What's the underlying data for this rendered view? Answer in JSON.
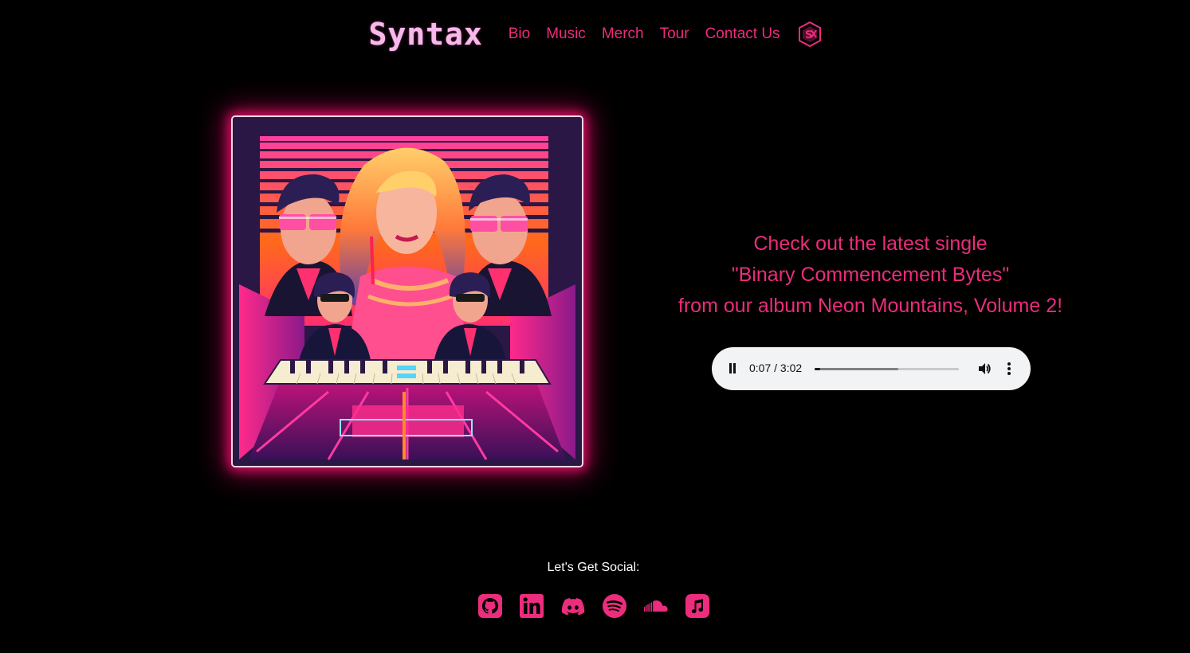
{
  "header": {
    "logo": "Syntax",
    "nav": [
      {
        "label": "Bio"
      },
      {
        "label": "Music"
      },
      {
        "label": "Merch"
      },
      {
        "label": "Tour"
      },
      {
        "label": "Contact Us"
      }
    ],
    "badge_icon": "band-emblem-icon"
  },
  "colors": {
    "accent": "#ec2c7c",
    "logo": "#f7b8ea",
    "background": "#000000",
    "player_bg": "#f1f3f4"
  },
  "album": {
    "icon": "album-cover-image"
  },
  "promo": {
    "line1": "Check out the latest single",
    "line2": "\"Binary Commencement Bytes\"",
    "line3": "from our album Neon Mountains, Volume 2!"
  },
  "player": {
    "time": "0:07 / 3:02",
    "played_fraction": 0.04,
    "buffered_fraction": 0.58,
    "state": "playing"
  },
  "social": {
    "label": "Let's Get Social:",
    "icons": [
      "github-icon",
      "linkedin-icon",
      "discord-icon",
      "spotify-icon",
      "soundcloud-icon",
      "apple-music-icon"
    ]
  }
}
